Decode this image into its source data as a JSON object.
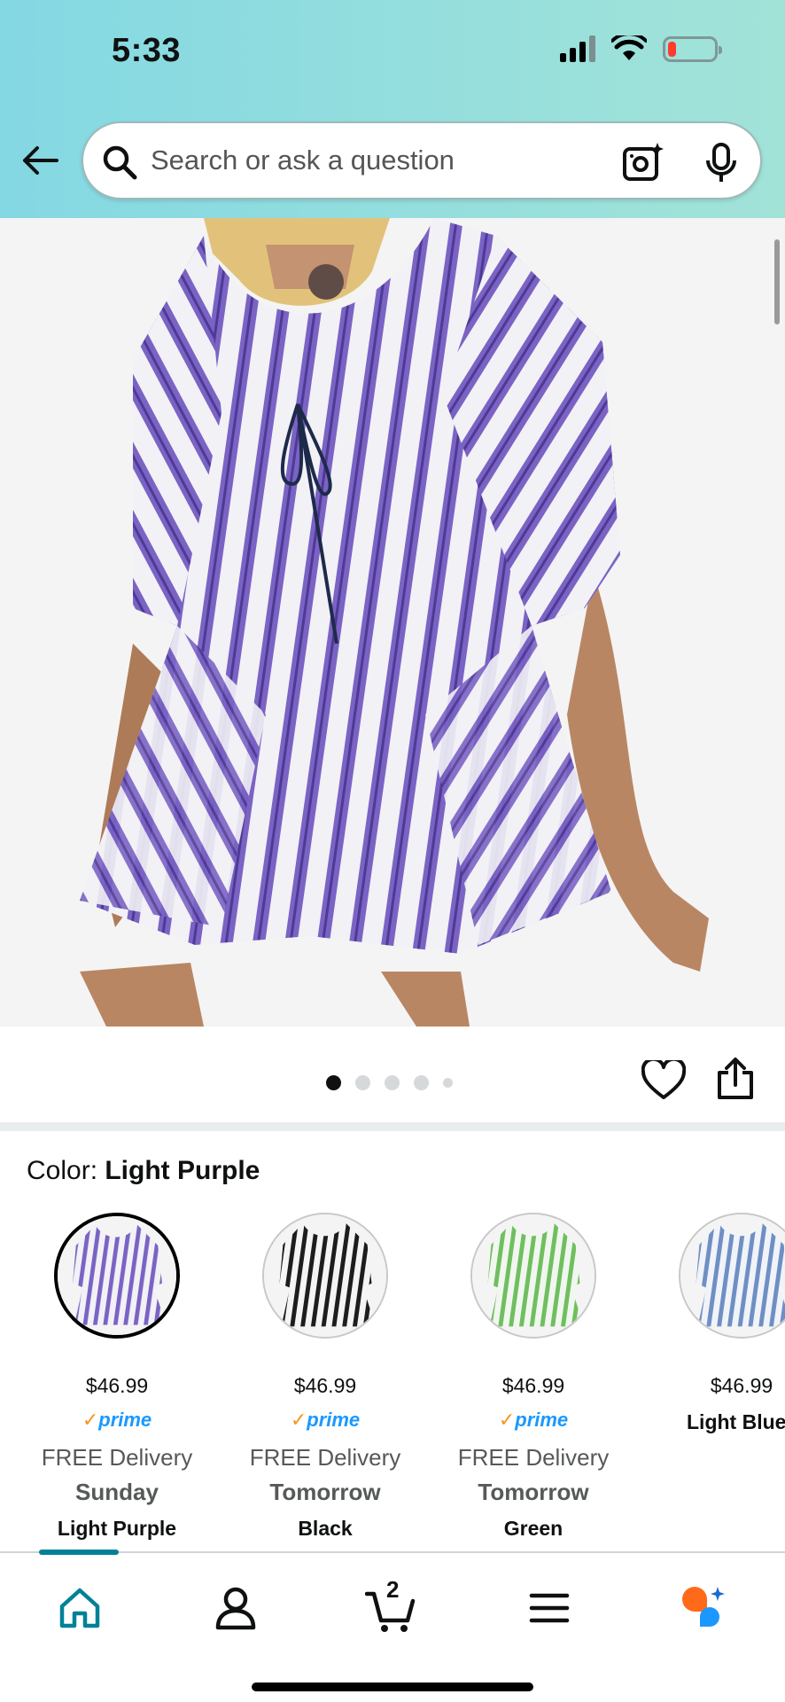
{
  "status_bar": {
    "time": "5:33",
    "icons": [
      "cellular-signal-icon",
      "wifi-icon",
      "battery-low-icon"
    ]
  },
  "search": {
    "placeholder": "Search or ask a question",
    "icons": [
      "back-arrow-icon",
      "search-icon",
      "camera-search-icon",
      "microphone-icon"
    ]
  },
  "gallery": {
    "image_count": 5,
    "active_index": 1,
    "actions": [
      "heart-icon",
      "share-icon"
    ]
  },
  "color": {
    "label_prefix": "Color: ",
    "selected": "Light Purple",
    "options": [
      {
        "price": "$46.99",
        "prime": "prime",
        "delivery": "FREE Delivery",
        "when": "Sunday",
        "name": "Light Purple",
        "stripe": "#7b63c4"
      },
      {
        "price": "$46.99",
        "prime": "prime",
        "delivery": "FREE Delivery",
        "when": "Tomorrow",
        "name": "Black",
        "stripe": "#1d1d1d"
      },
      {
        "price": "$46.99",
        "prime": "prime",
        "delivery": "FREE Delivery",
        "when": "Tomorrow",
        "name": "Green",
        "stripe": "#6fbf5f"
      },
      {
        "price": "$46.99",
        "name": "Light Blue",
        "stripe": "#6f8fc4"
      }
    ]
  },
  "bottom_nav": {
    "items": [
      "home-icon",
      "account-icon",
      "cart-icon",
      "menu-icon",
      "rufus-icon"
    ],
    "cart_count": "2",
    "accent": "#008296"
  },
  "colors": {
    "header_gradient_start": "#84d8e3",
    "header_gradient_end": "#a2e3d8",
    "prime_blue": "#1a98ff",
    "prime_check": "#f7961d"
  }
}
